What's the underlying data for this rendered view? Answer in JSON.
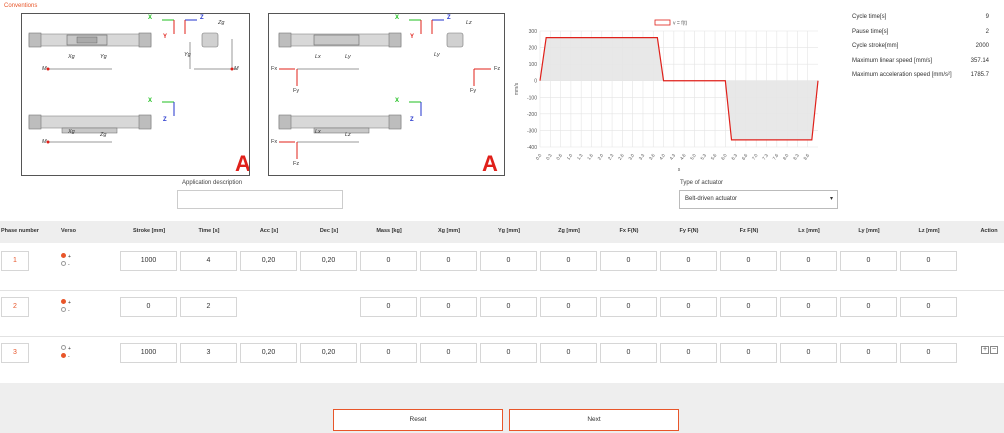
{
  "conventions_title": "Conventions",
  "diagram_labels": {
    "left": {
      "x": "X",
      "y": "Y",
      "z": "Z",
      "zg_top": "Zg",
      "yg_top": "Yg",
      "xg_top": "Xg",
      "m": "M",
      "x2": "X",
      "z2": "Z",
      "xg2": "Xg",
      "zg2": "Zg",
      "yg2": "Yg",
      "m2": "M",
      "big": "A"
    },
    "right": {
      "x": "X",
      "y": "Y",
      "z": "Z",
      "lz": "Lz",
      "ly": "Ly",
      "lx": "Lx",
      "fx": "Fx",
      "fy": "Fy",
      "fz": "Fz",
      "x2": "X",
      "z2": "Z",
      "lx2": "Lx",
      "lz2": "Lz",
      "fx2": "Fx",
      "fz2": "Fz",
      "big": "A"
    }
  },
  "application": {
    "label": "Application description",
    "value": ""
  },
  "actuator": {
    "label": "Type of actuator",
    "selected": "Belt-driven actuator"
  },
  "stats": [
    {
      "label": "Cycle time[s]",
      "value": "9"
    },
    {
      "label": "Pause time[s]",
      "value": "2"
    },
    {
      "label": "Cycle stroke[mm]",
      "value": "2000"
    },
    {
      "label": "Maximum linear speed [mm/s]",
      "value": "357.14"
    },
    {
      "label": "Maximum acceleration speed [mm/s²]",
      "value": "1785.7"
    }
  ],
  "chart_data": {
    "type": "line",
    "legend": "v = f(t)",
    "ylabel": "mm/s",
    "xlabel": "s",
    "ylim": [
      -400,
      300
    ],
    "yticks": [
      300,
      200,
      100,
      0,
      -100,
      -200,
      -300,
      -400
    ],
    "xticks": [
      "0.0",
      "0.3",
      "0.6",
      "1.0",
      "1.3",
      "1.6",
      "2.0",
      "2.3",
      "2.6",
      "3.0",
      "3.3",
      "3.6",
      "4.0",
      "4.3",
      "4.6",
      "5.0",
      "5.3",
      "5.6",
      "6.0",
      "6.3",
      "6.6",
      "7.0",
      "7.3",
      "7.6",
      "8.0",
      "8.3",
      "8.6"
    ],
    "xlim": [
      0,
      9
    ],
    "series": [
      {
        "x": [
          0,
          0.2,
          3.8,
          4.0,
          6.0,
          6.2,
          8.8,
          9.0
        ],
        "y": [
          0,
          260,
          260,
          0,
          0,
          -357,
          -357,
          0
        ]
      }
    ],
    "grid": true,
    "legend_position": "top"
  },
  "table": {
    "headers": [
      "Phase number",
      "Verso",
      "Stroke [mm]",
      "Time [s]",
      "Acc [s]",
      "Dec [s]",
      "Mass [kg]",
      "Xg [mm]",
      "Yg [mm]",
      "Zg [mm]",
      "Fx F(N)",
      "Fy F(N)",
      "Fz F(N)",
      "Lx [mm]",
      "Ly [mm]",
      "Lz [mm]",
      "Action"
    ],
    "plus": "+",
    "minus": "-",
    "rows": [
      {
        "phase": "1",
        "verso": "+",
        "stroke": "1000",
        "time": "4",
        "acc": "0,20",
        "dec": "0,20",
        "mass": "0",
        "xg": "0",
        "yg": "0",
        "zg": "0",
        "fx": "0",
        "fy": "0",
        "fz": "0",
        "lx": "0",
        "ly": "0",
        "lz": "0"
      },
      {
        "phase": "2",
        "verso": "+",
        "stroke": "0",
        "time": "2",
        "mass": "0",
        "xg": "0",
        "yg": "0",
        "zg": "0",
        "fx": "0",
        "fy": "0",
        "fz": "0",
        "lx": "0",
        "ly": "0",
        "lz": "0"
      },
      {
        "phase": "3",
        "verso": "-",
        "stroke": "1000",
        "time": "3",
        "acc": "0,20",
        "dec": "0,20",
        "mass": "0",
        "xg": "0",
        "yg": "0",
        "zg": "0",
        "fx": "0",
        "fy": "0",
        "fz": "0",
        "lx": "0",
        "ly": "0",
        "lz": "0"
      }
    ],
    "action_add": "+",
    "action_remove": "−"
  },
  "buttons": {
    "reset": "Reset",
    "next": "Next"
  },
  "colors": {
    "accent": "#e8562a",
    "line": "#e0201a",
    "fill": "#e6e6e6"
  }
}
